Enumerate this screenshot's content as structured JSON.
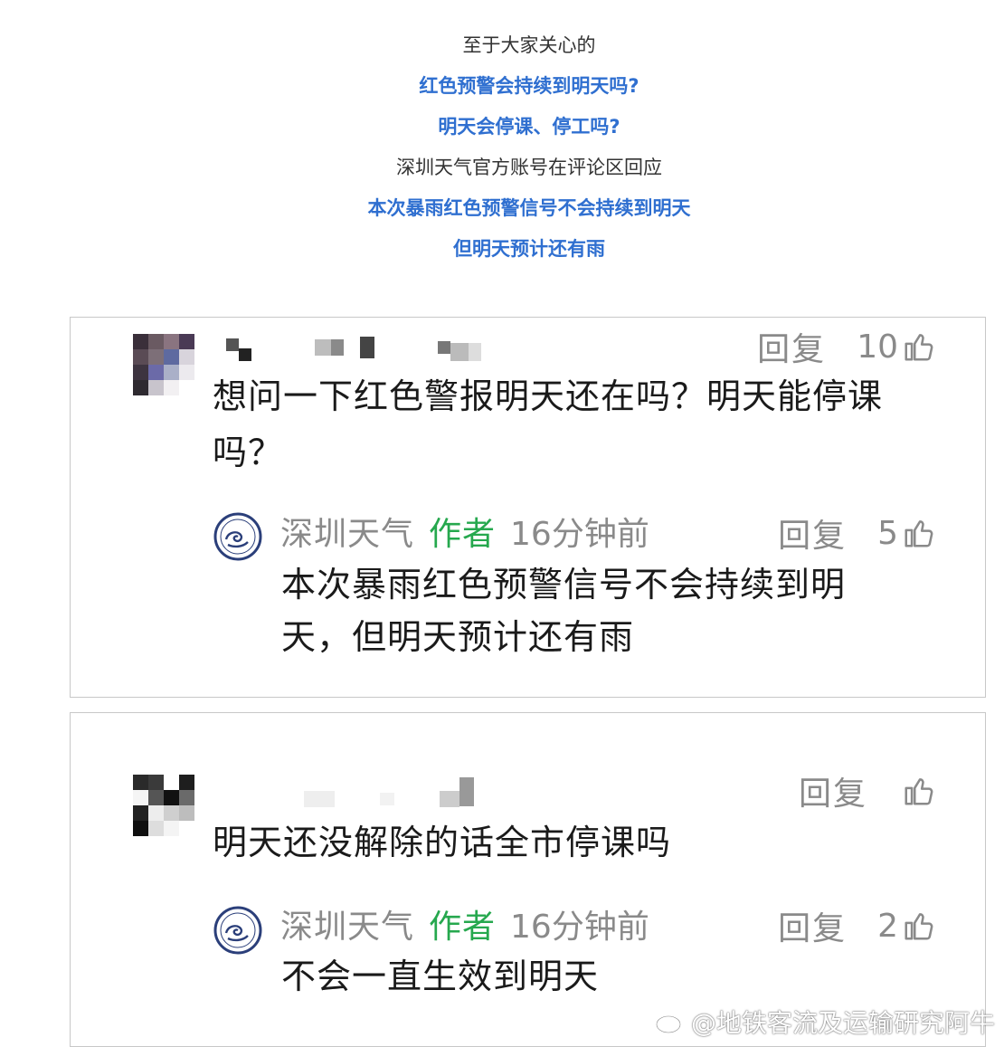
{
  "intro": {
    "lines": [
      "至于大家关心的",
      "红色预警会持续到明天吗?",
      "明天会停课、停工吗?",
      "深圳天气官方账号在评论区回应",
      "本次暴雨红色预警信号不会持续到明天",
      "但明天预计还有雨"
    ]
  },
  "comments": [
    {
      "reply_label": "回复",
      "likes": "10",
      "text_line1": "想问一下红色警报明天还在吗？明天能停课",
      "text_line2": "吗？",
      "reply": {
        "author": "深圳天气",
        "badge": "作者",
        "time": "16分钟前",
        "reply_label": "回复",
        "likes": "5",
        "text_line1": "本次暴雨红色预警信号不会持续到明",
        "text_line2": "天，但明天预计还有雨"
      }
    },
    {
      "reply_label": "回复",
      "likes": "",
      "text_line1": "明天还没解除的话全市停课吗",
      "reply": {
        "author": "深圳天气",
        "badge": "作者",
        "time": "16分钟前",
        "reply_label": "回复",
        "likes": "2",
        "text_line1": "不会一直生效到明天"
      }
    }
  ],
  "watermark": "@地铁客流及运输研究阿牛",
  "colors": {
    "blue_text": "#2f6fd0",
    "author_badge": "#26a84e",
    "meta_gray": "#8a8a8a",
    "border": "#c8c8c8"
  },
  "icons": [
    "thumbs-up-icon",
    "weather-logo-icon",
    "weibo-icon"
  ]
}
